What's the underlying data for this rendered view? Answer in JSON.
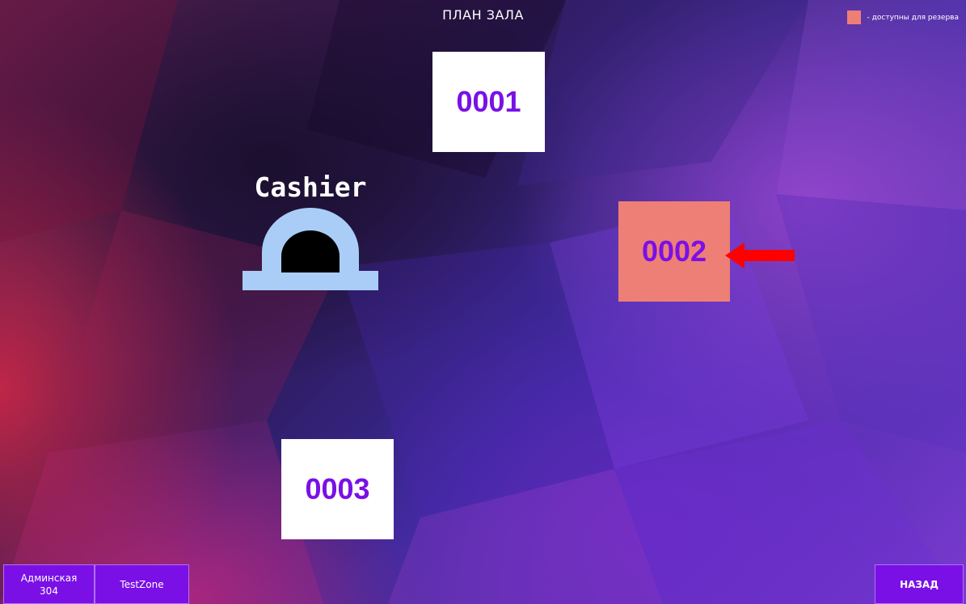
{
  "header": {
    "title": "ПЛАН ЗАЛА",
    "legend_label": "- доступны для резерва",
    "legend_color": "#ee7f76"
  },
  "tables": [
    {
      "number": "0001",
      "status": "normal",
      "color": "#ffffff"
    },
    {
      "number": "0002",
      "status": "available-for-reservation",
      "color": "#ee7f76"
    },
    {
      "number": "0003",
      "status": "normal",
      "color": "#ffffff"
    }
  ],
  "cashier": {
    "label": "Cashier",
    "icon": "cashier-desk-icon"
  },
  "annotation": {
    "icon": "red-arrow-icon",
    "color": "#ff0000"
  },
  "footer": {
    "user_name": "Админская",
    "user_number": "304",
    "zone": "TestZone",
    "back_label": "НАЗАД"
  },
  "colors": {
    "accent": "#7a10e6",
    "table_text": "#7a10e6"
  }
}
